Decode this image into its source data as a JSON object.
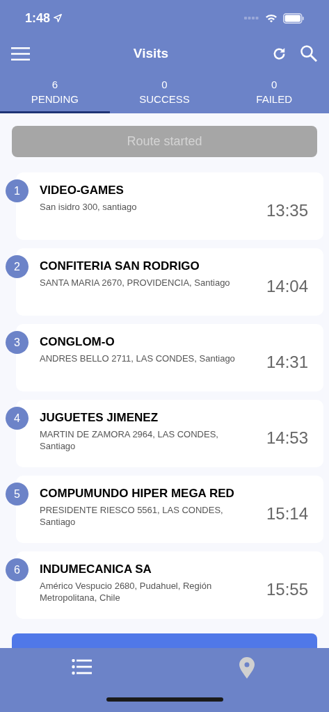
{
  "status_bar": {
    "time": "1:48"
  },
  "header": {
    "title": "Visits"
  },
  "tabs": [
    {
      "count": "6",
      "label": "PENDING",
      "selected": true
    },
    {
      "count": "0",
      "label": "SUCCESS",
      "selected": false
    },
    {
      "count": "0",
      "label": "FAILED",
      "selected": false
    }
  ],
  "route_button": {
    "label": "Route started",
    "disabled": true
  },
  "visits": [
    {
      "number": "1",
      "name": "VIDEO-GAMES",
      "address": "San isidro 300, santiago",
      "time": "13:35"
    },
    {
      "number": "2",
      "name": "CONFITERIA SAN RODRIGO",
      "address": "SANTA MARIA 2670, PROVIDENCIA, Santiago",
      "time": "14:04"
    },
    {
      "number": "3",
      "name": "CONGLOM-O",
      "address": "ANDRES BELLO 2711, LAS CONDES, Santiago",
      "time": "14:31"
    },
    {
      "number": "4",
      "name": "JUGUETES JIMENEZ",
      "address": "MARTIN DE ZAMORA 2964, LAS CONDES, Santiago",
      "time": "14:53"
    },
    {
      "number": "5",
      "name": "COMPUMUNDO HIPER MEGA RED",
      "address": "PRESIDENTE RIESCO 5561, LAS CONDES, Santiago",
      "time": "15:14"
    },
    {
      "number": "6",
      "name": "INDUMECANICA SA",
      "address": "Américo Vespucio 2680, Pudahuel, Región Metropolitana, Chile",
      "time": "15:55"
    }
  ],
  "bottom_nav": [
    {
      "kind": "list",
      "selected": true
    },
    {
      "kind": "map",
      "selected": false
    }
  ]
}
